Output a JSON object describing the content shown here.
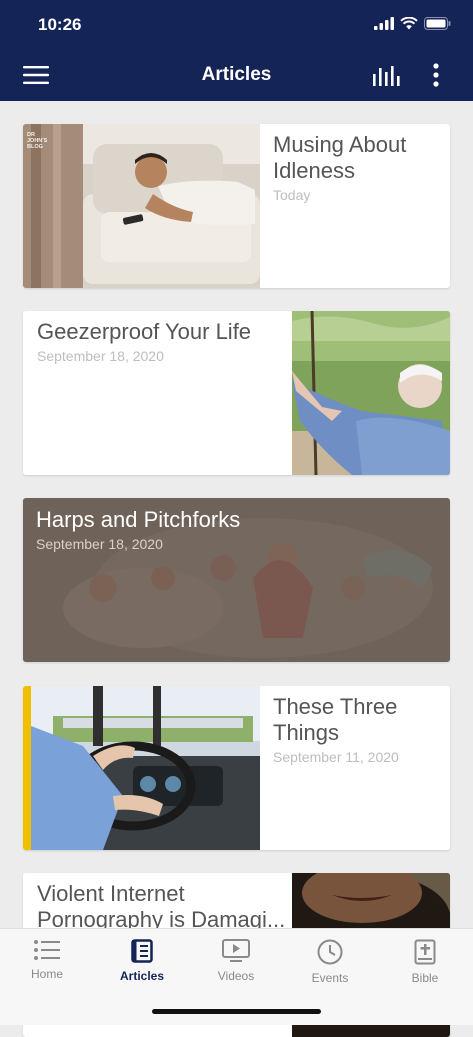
{
  "status": {
    "time": "10:26"
  },
  "appbar": {
    "title": "Articles"
  },
  "articles": [
    {
      "title": "Musing About Idleness",
      "date": "Today",
      "thumb_label": "DR JOHN'S BLOG"
    },
    {
      "title": "Geezerproof Your Life",
      "date": "September 18, 2020"
    },
    {
      "title": "Harps and Pitchforks",
      "date": "September 18, 2020"
    },
    {
      "title": "These Three Things",
      "date": "September 11, 2020"
    },
    {
      "title": "Violent Internet Pornography is Damagi...",
      "date": ""
    }
  ],
  "tabs": [
    {
      "label": "Home",
      "icon": "list-icon"
    },
    {
      "label": "Articles",
      "icon": "book-icon",
      "active": true
    },
    {
      "label": "Videos",
      "icon": "play-screen-icon"
    },
    {
      "label": "Events",
      "icon": "clock-icon"
    },
    {
      "label": "Bible",
      "icon": "bible-icon"
    }
  ],
  "colors": {
    "navy": "#142457",
    "background": "#ececec"
  }
}
